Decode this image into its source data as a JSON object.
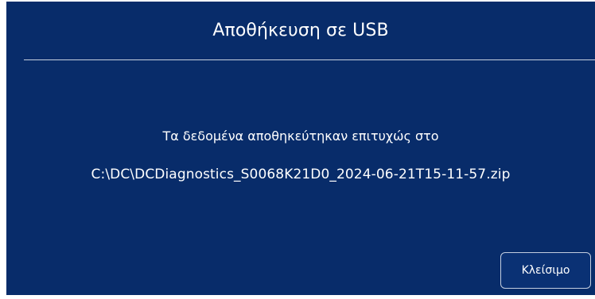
{
  "dialog": {
    "title": "Αποθήκευση σε USB",
    "message": "Τα δεδομένα αποθηκεύτηκαν επιτυχώς στο",
    "file_path": "C:\\DC\\DCDiagnostics_S0068K21D0_2024-06-21T15-11-57.zip",
    "close_label": "Κλείσιμο"
  },
  "colors": {
    "dialog_background": "#082c6a",
    "text": "#ffffff",
    "divider": "#c7d0df",
    "button_border": "#c3cee0"
  }
}
